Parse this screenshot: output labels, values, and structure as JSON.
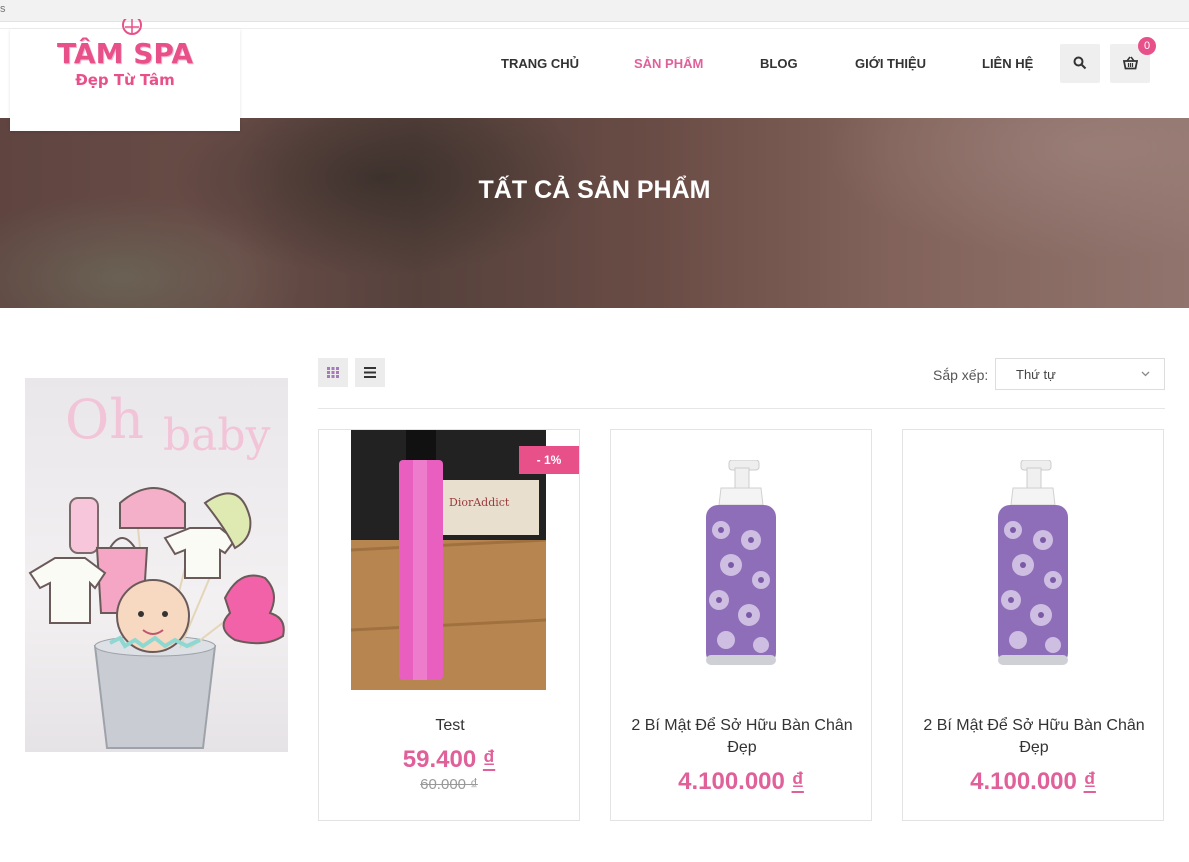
{
  "topbar": {
    "text": "s"
  },
  "brand": {
    "name": "TÂM SPA",
    "tagline": "Đẹp Từ Tâm",
    "color": "#e8508a"
  },
  "nav": {
    "items": [
      {
        "label": "TRANG CHỦ"
      },
      {
        "label": "SẢN PHẨM",
        "active": true
      },
      {
        "label": "BLOG"
      },
      {
        "label": "GIỚI THIỆU"
      },
      {
        "label": "LIÊN HỆ"
      }
    ],
    "search_icon": "search-icon",
    "cart_icon": "basket-icon",
    "cart_count": "0"
  },
  "hero": {
    "title": "TẤT CẢ SẢN PHẨM"
  },
  "sidebar": {
    "banner_text_1": "Oh",
    "banner_text_2": "baby"
  },
  "toolbar": {
    "grid_icon": "grid-view-icon",
    "list_icon": "list-view-icon",
    "sort_label": "Sắp xếp:",
    "sort_value": "Thứ tự"
  },
  "products": [
    {
      "name": "Test",
      "price": "59.400",
      "currency": "₫",
      "old_price": "60.000 ₫",
      "badge": "- 1%"
    },
    {
      "name": "2 Bí Mật Để Sở Hữu Bàn Chân Đẹp",
      "price": "4.100.000",
      "currency": "₫"
    },
    {
      "name": "2 Bí Mật Để Sở Hữu Bàn Chân Đẹp",
      "price": "4.100.000",
      "currency": "₫"
    }
  ],
  "colors": {
    "accent": "#e0609a",
    "badge": "#e8508a"
  }
}
